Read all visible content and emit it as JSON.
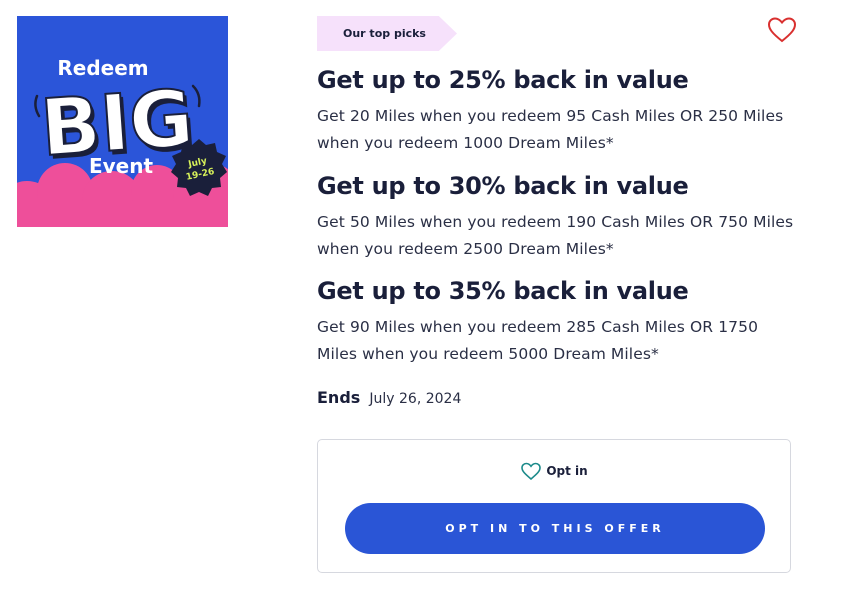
{
  "promo_image": {
    "line1": "Redeem",
    "line2": "BIG",
    "line3": "Event",
    "date_line1": "July",
    "date_line2": "19-26"
  },
  "badge": {
    "label": "Our top picks"
  },
  "save_icon": "heart-outline-icon",
  "offers": [
    {
      "title": "Get up to 25% back in value",
      "description": "Get 20 Miles when you redeem 95 Cash Miles OR 250 Miles when you redeem 1000 Dream Miles*"
    },
    {
      "title": "Get up to 30% back in value",
      "description": "Get 50 Miles when you redeem 190 Cash Miles OR 750 Miles when you redeem 2500 Dream Miles*"
    },
    {
      "title": "Get up to 35% back in value",
      "description": "Get 90 Miles when you redeem 285 Cash Miles OR 1750 Miles when you redeem 5000 Dream Miles*"
    }
  ],
  "ends": {
    "label": "Ends",
    "date": "July 26, 2024"
  },
  "optin": {
    "status_label": "Opt in",
    "button_label": "OPT IN TO THIS OFFER"
  },
  "colors": {
    "brand_blue": "#2a55d6",
    "promo_pink": "#ee4f9a",
    "badge_bg": "#f6e1fb",
    "heart_red": "#d9302f",
    "optin_heart": "#1c8a8a",
    "date_green": "#d8f25a"
  }
}
